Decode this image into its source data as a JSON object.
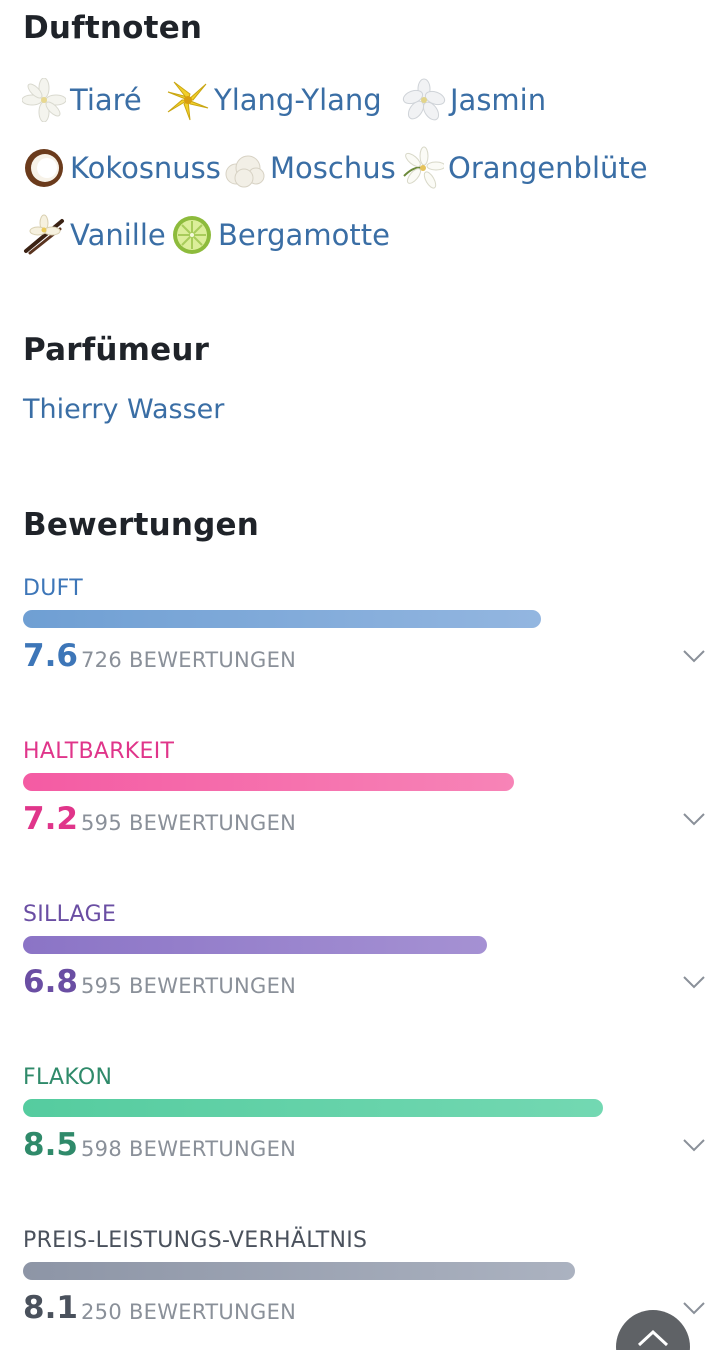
{
  "notes_section": {
    "title": "Duftnoten",
    "notes": [
      {
        "label": "Tiaré",
        "icon": "tiare-flower-icon"
      },
      {
        "label": "Ylang-Ylang",
        "icon": "ylang-ylang-flower-icon"
      },
      {
        "label": "Jasmin",
        "icon": "jasmine-flower-icon"
      },
      {
        "label": "Kokosnuss",
        "icon": "coconut-icon"
      },
      {
        "label": "Moschus",
        "icon": "musk-icon"
      },
      {
        "label": "Orangenblüte",
        "icon": "orange-blossom-icon"
      },
      {
        "label": "Vanille",
        "icon": "vanilla-icon"
      },
      {
        "label": "Bergamotte",
        "icon": "bergamot-icon"
      }
    ]
  },
  "perfumer_section": {
    "title": "Parfümeur",
    "name": "Thierry Wasser"
  },
  "ratings_section": {
    "title": "Bewertungen",
    "scale_max": 10,
    "ratings": [
      {
        "label": "DUFT",
        "score": "7.6",
        "value": 7.6,
        "count": "726 BEWERTUNGEN",
        "color": "#3d76b8",
        "bar_from": "#6f9fd3",
        "bar_to": "#93b6e0"
      },
      {
        "label": "HALTBARKEIT",
        "score": "7.2",
        "value": 7.2,
        "count": "595 BEWERTUNGEN",
        "color": "#e0358a",
        "bar_from": "#f45ba3",
        "bar_to": "#f784b7"
      },
      {
        "label": "SILLAGE",
        "score": "6.8",
        "value": 6.8,
        "count": "595 BEWERTUNGEN",
        "color": "#6a4ea3",
        "bar_from": "#8b74c6",
        "bar_to": "#a591d3"
      },
      {
        "label": "FLAKON",
        "score": "8.5",
        "value": 8.5,
        "count": "598 BEWERTUNGEN",
        "color": "#2f8a6a",
        "bar_from": "#55cc9f",
        "bar_to": "#73d8b2"
      },
      {
        "label": "PREIS-LEISTUNGS-VERHÄLTNIS",
        "score": "8.1",
        "value": 8.1,
        "count": "250 BEWERTUNGEN",
        "color": "#4a515c",
        "bar_from": "#8d95a6",
        "bar_to": "#abb2c0"
      }
    ]
  },
  "scroll_top_button": {
    "icon": "chevron-up-icon"
  }
}
